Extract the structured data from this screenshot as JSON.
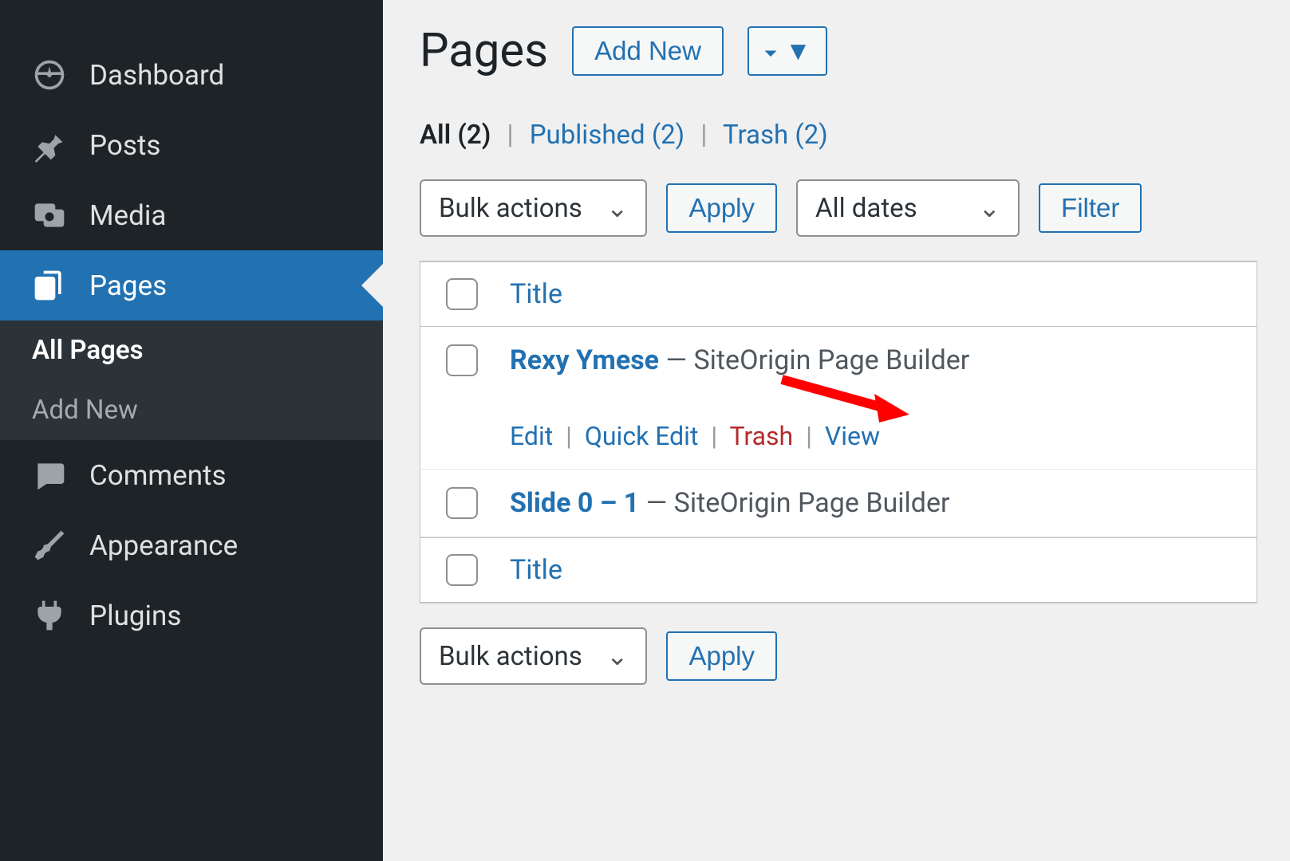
{
  "sidebar": {
    "items": [
      {
        "label": "Dashboard",
        "icon": "dashboard-icon"
      },
      {
        "label": "Posts",
        "icon": "pin-icon"
      },
      {
        "label": "Media",
        "icon": "media-icon"
      },
      {
        "label": "Pages",
        "icon": "pages-icon",
        "active": true
      },
      {
        "label": "Comments",
        "icon": "comments-icon"
      },
      {
        "label": "Appearance",
        "icon": "brush-icon"
      },
      {
        "label": "Plugins",
        "icon": "plug-icon"
      }
    ],
    "submenu": [
      {
        "label": "All Pages",
        "current": true
      },
      {
        "label": "Add New"
      }
    ]
  },
  "header": {
    "title": "Pages",
    "add_new_label": "Add New"
  },
  "filters": {
    "all_label": "All",
    "all_count": "(2)",
    "published_label": "Published",
    "published_count": "(2)",
    "trash_label": "Trash",
    "trash_count": "(2)"
  },
  "toolbar": {
    "bulk_label": "Bulk actions",
    "apply_label": "Apply",
    "dates_label": "All dates",
    "filter_label": "Filter"
  },
  "table": {
    "title_header": "Title",
    "rows": [
      {
        "title": "Rexy Ymese",
        "suffix": "— SiteOrigin Page Builder",
        "actions": {
          "edit": "Edit",
          "quick": "Quick Edit",
          "trash": "Trash",
          "view": "View"
        },
        "show_actions": true
      },
      {
        "title": "Slide 0 – 1",
        "suffix": "— SiteOrigin Page Builder",
        "show_actions": false
      }
    ]
  },
  "colors": {
    "accent": "#2271b1",
    "sidebar_bg": "#1d2327",
    "danger": "#b32d2e",
    "arrow": "#ff0000"
  }
}
